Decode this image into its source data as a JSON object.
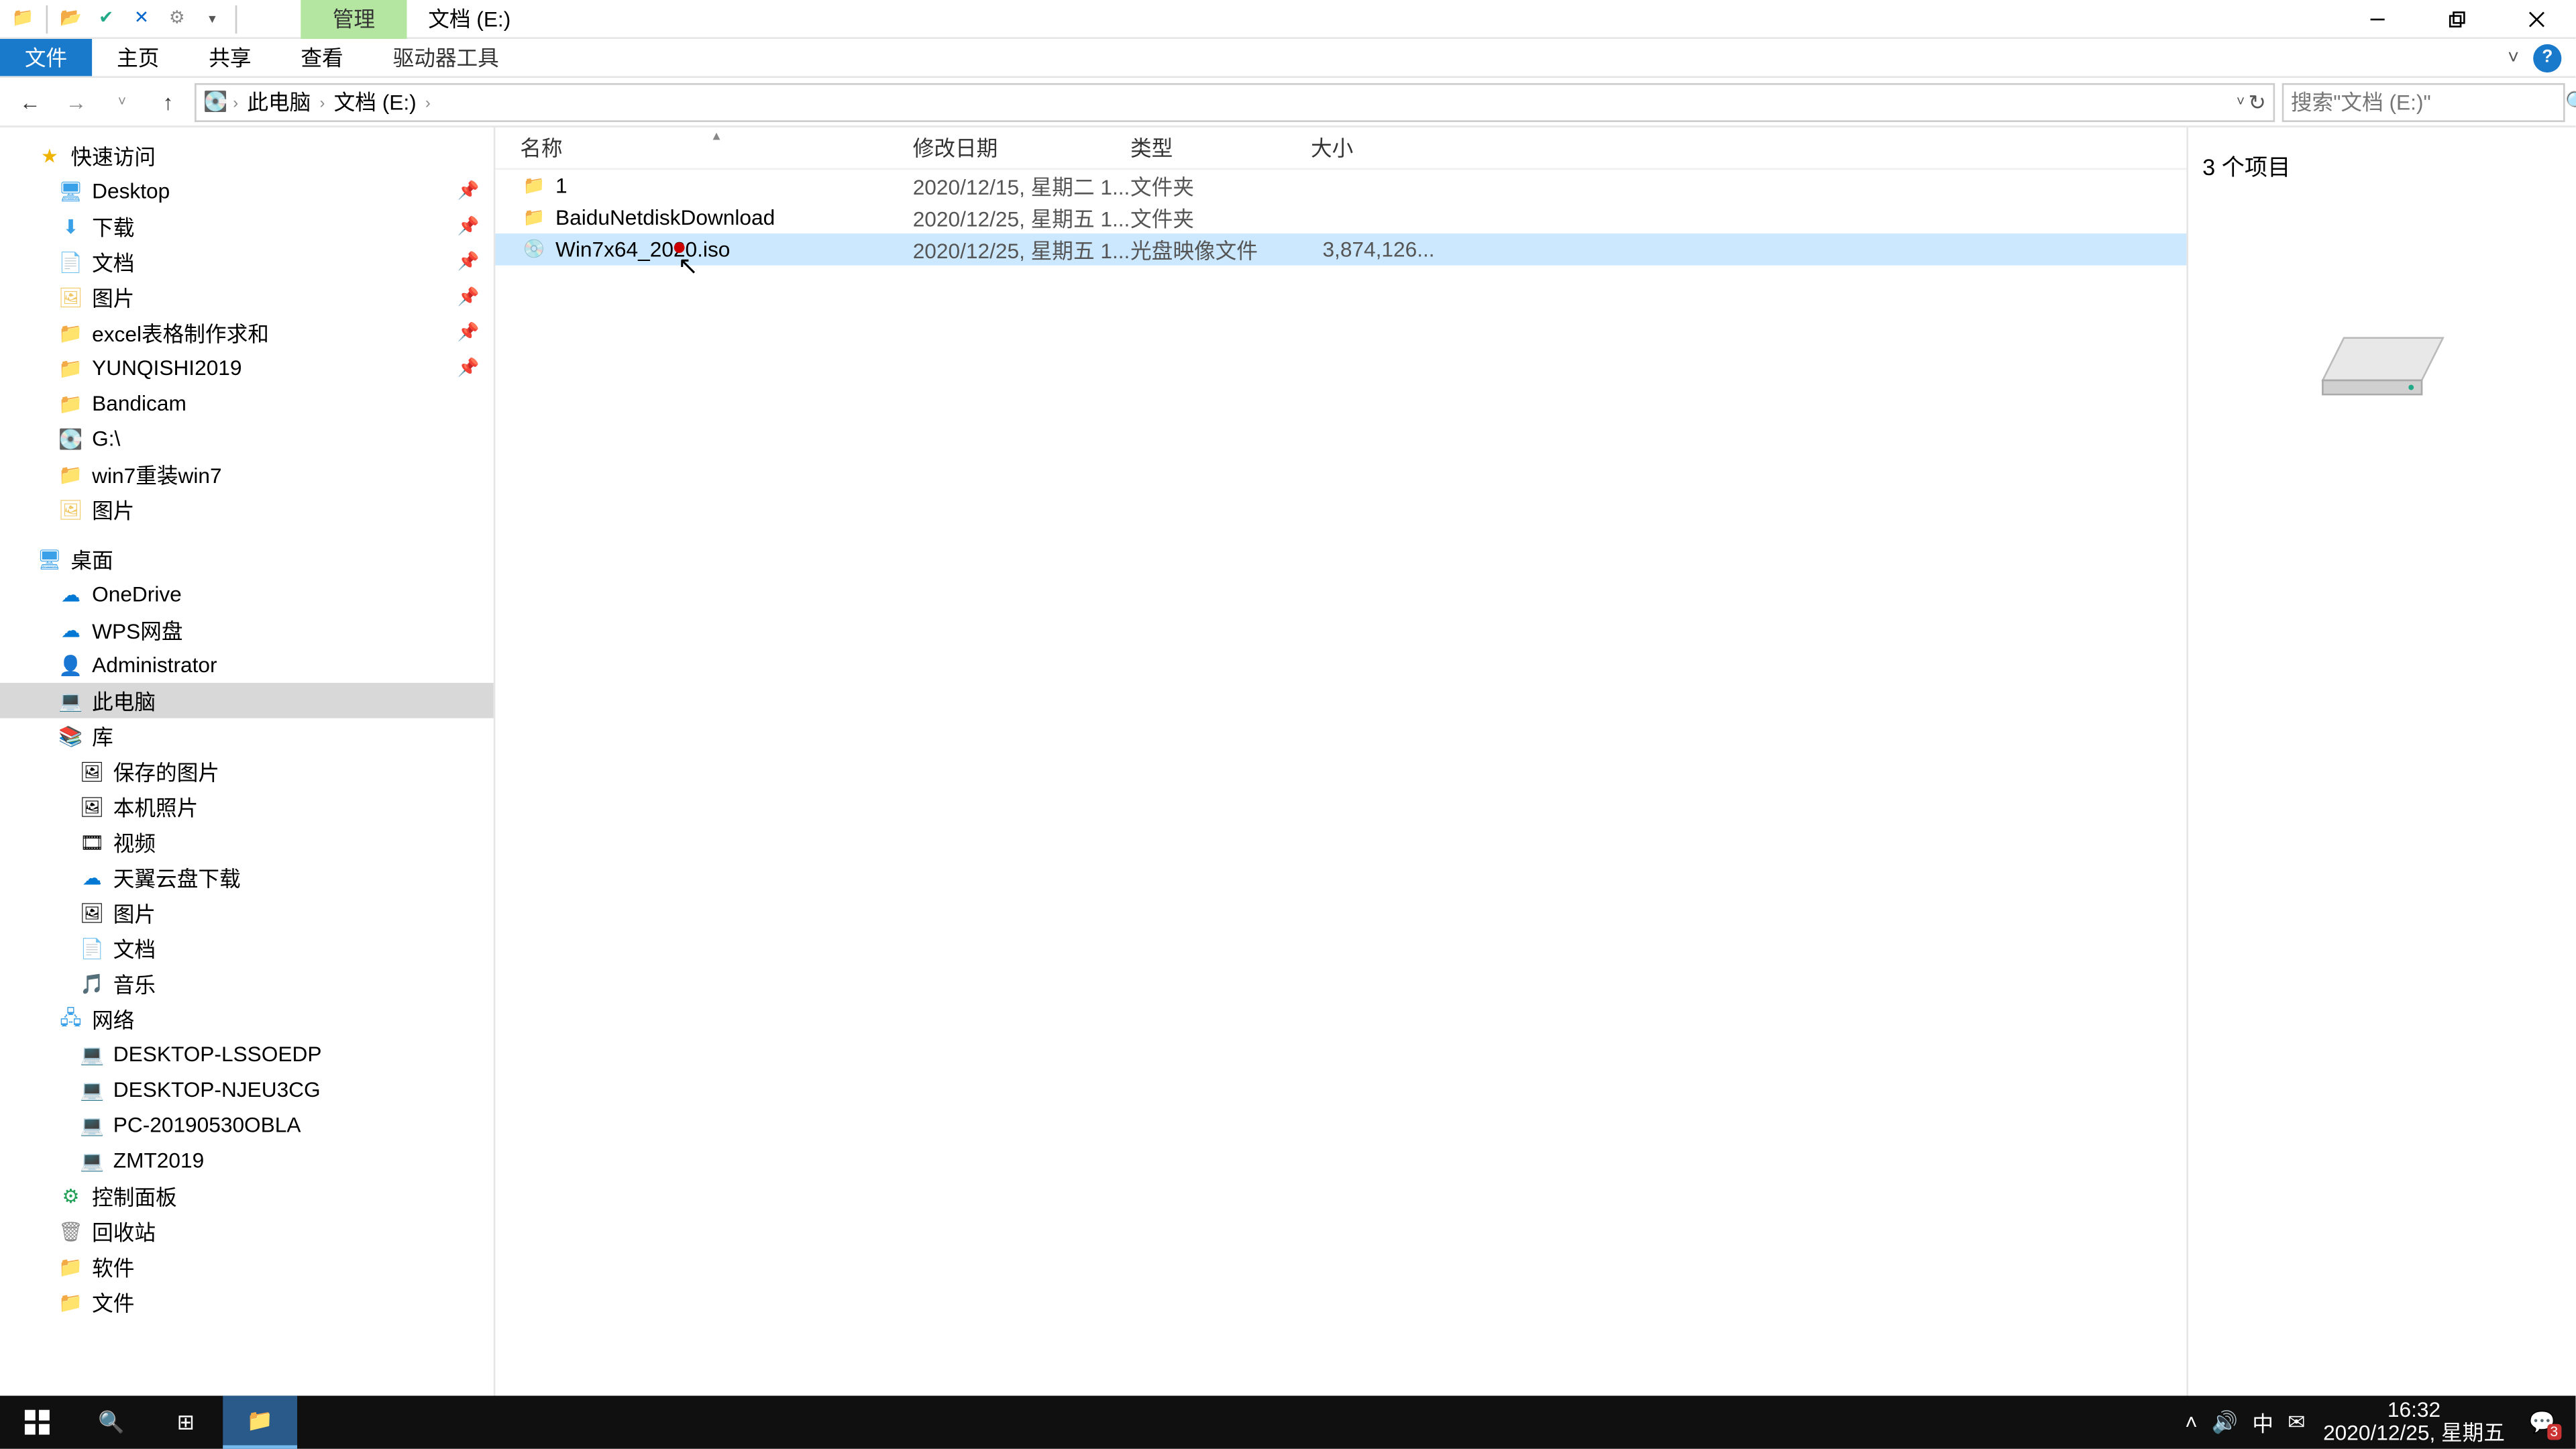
{
  "title": "文档 (E:)",
  "context_tab": "管理",
  "ribbon": {
    "file": "文件",
    "home": "主页",
    "share": "共享",
    "view": "查看",
    "drive_tools": "驱动器工具",
    "expand": "˅"
  },
  "breadcrumbs": {
    "root": "此电脑",
    "drive": "文档 (E:)"
  },
  "search": {
    "placeholder": "搜索\"文档 (E:)\""
  },
  "columns": {
    "name": "名称",
    "date": "修改日期",
    "type": "类型",
    "size": "大小"
  },
  "files": [
    {
      "icon": "folder",
      "name": "1",
      "date": "2020/12/15, 星期二 1...",
      "type": "文件夹",
      "size": ""
    },
    {
      "icon": "folder",
      "name": "BaiduNetdiskDownload",
      "date": "2020/12/25, 星期五 1...",
      "type": "文件夹",
      "size": ""
    },
    {
      "icon": "iso",
      "name": "Win7x64_2020.iso",
      "date": "2020/12/25, 星期五 1...",
      "type": "光盘映像文件",
      "size": "3,874,126..."
    }
  ],
  "selected_index": 2,
  "tree": {
    "quick": "快速访问",
    "quick_items": [
      "Desktop",
      "下载",
      "文档",
      "图片",
      "excel表格制作求和",
      "YUNQISHI2019",
      "Bandicam",
      "G:\\",
      "win7重装win7",
      "图片"
    ],
    "desktop": "桌面",
    "desktop_items": [
      "OneDrive",
      "WPS网盘",
      "Administrator",
      "此电脑",
      "库",
      "网络",
      "控制面板",
      "回收站",
      "软件",
      "文件"
    ],
    "lib_items": [
      "保存的图片",
      "本机照片",
      "视频",
      "天翼云盘下载",
      "图片",
      "文档",
      "音乐"
    ],
    "net_items": [
      "DESKTOP-LSSOEDP",
      "DESKTOP-NJEU3CG",
      "PC-20190530OBLA",
      "ZMT2019"
    ]
  },
  "preview": {
    "count": "3 个项目"
  },
  "status": {
    "text": "3 个项目"
  },
  "taskbar": {
    "time": "16:32",
    "date": "2020/12/25, 星期五",
    "ime": "中",
    "notif_count": "3"
  }
}
